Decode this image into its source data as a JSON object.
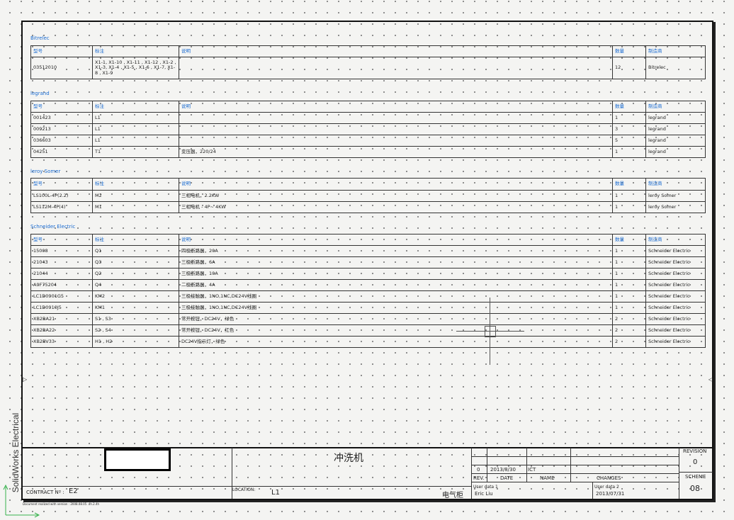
{
  "groups": [
    {
      "name": "Bitrelec",
      "headers": [
        "型号",
        "标注",
        "说明",
        "数量",
        "制造商"
      ],
      "rows": [
        {
          "ref": "03512010",
          "mark": "X1-1, X1-10 , X1-11 , X1-12 , X1-2 , X1-3, X1-4 , X1-5 , X1-6 , X1-7, X1-8 , X1-9",
          "desc": "",
          "qty": "12",
          "maker": "Bitrelec"
        }
      ]
    },
    {
      "name": "legrand",
      "headers": [
        "型号",
        "标注",
        "说明",
        "数量",
        "制造商"
      ],
      "rows": [
        {
          "ref": "001423",
          "mark": "L1",
          "desc": "",
          "qty": "1",
          "maker": "legrand"
        },
        {
          "ref": "009213",
          "mark": "L1",
          "desc": "",
          "qty": "3",
          "maker": "legrand"
        },
        {
          "ref": "036603",
          "mark": "L1",
          "desc": "",
          "qty": "5",
          "maker": "legrand"
        },
        {
          "ref": "04251",
          "mark": "T1",
          "desc": "变压器，220/24",
          "qty": "1",
          "maker": "legrand"
        }
      ]
    },
    {
      "name": "leroy Somer",
      "headers": [
        "型号",
        "标注",
        "说明",
        "数量",
        "制造商"
      ],
      "rows": [
        {
          "ref": "LS100L-4P(2.2)",
          "mark": "M2",
          "desc": "三相电机，2.2KW",
          "qty": "1",
          "maker": "leroy Somer"
        },
        {
          "ref": "LS112M-4P(4)",
          "mark": "M1",
          "desc": "三相电机 - 4P~ 4KW",
          "qty": "1",
          "maker": "leroy Somer"
        }
      ]
    },
    {
      "name": "Schneider Electric",
      "headers": [
        "型号",
        "标注",
        "说明",
        "数量",
        "制造商"
      ],
      "rows": [
        {
          "ref": "15008",
          "mark": "Q1",
          "desc": "四极断路器，20A",
          "qty": "1",
          "maker": "Schneider Electric"
        },
        {
          "ref": "21043",
          "mark": "Q3",
          "desc": "三极断路器，6A",
          "qty": "1",
          "maker": "Schneider Electric"
        },
        {
          "ref": "21044",
          "mark": "Q2",
          "desc": "三极断路器，10A",
          "qty": "1",
          "maker": "Schneider Electric"
        },
        {
          "ref": "A9F75204",
          "mark": "Q4",
          "desc": "二极断路器，4A",
          "qty": "1",
          "maker": "Schneider Electric"
        },
        {
          "ref": "LC1D0901G5",
          "mark": "KM2",
          "desc": "三极接触器，1NO,1NC,DC24V线圈",
          "qty": "1",
          "maker": "Schneider Electric"
        },
        {
          "ref": "LC1D0910J5",
          "mark": "KM1",
          "desc": "三极接触器，1NO,1NC,DC24V线圈",
          "qty": "1",
          "maker": "Schneider Electric"
        },
        {
          "ref": "XB2BA21",
          "mark": "S1 , S3",
          "desc": "常开按钮，DC24V，绿色",
          "qty": "2",
          "maker": "Schneider Electric"
        },
        {
          "ref": "XB2BA22",
          "mark": "S2 , S4",
          "desc": "常开按钮，DC24V，红色",
          "qty": "2",
          "maker": "Schneider Electric"
        },
        {
          "ref": "XB2BV33",
          "mark": "H1 , H2",
          "desc": "DC24V指示灯，绿色",
          "qty": "2",
          "maker": "Schneider Electric"
        }
      ]
    }
  ],
  "title_block": {
    "sidebar_label": "SolidWorks Electrical",
    "drawing_title": "冲洗机",
    "contract_label": "CONTRACT Nº :",
    "contract_value": "E2",
    "location_label": "LOCATION:",
    "location_value": "L1",
    "cabinet": "电气柜",
    "rev_row_rev": "0",
    "rev_row_date": "2013/8/30",
    "rev_row_name": "ICT",
    "hdr_rev": "REV.",
    "hdr_date": "DATE",
    "hdr_name": "NAME",
    "hdr_changes": "CHANGES",
    "user_data_1_label": "User data 1",
    "user_data_1_value": "Eric Liu",
    "user_data_2_label": "User data 2",
    "user_data_2_value": "2013/07/31",
    "revision_label": "REVISION",
    "revision_value": "0",
    "scheme_label": "SCHEME",
    "scheme_value": "08",
    "footer_note": "Document realized with version : 2008.08.05 .4h.2.4h"
  }
}
